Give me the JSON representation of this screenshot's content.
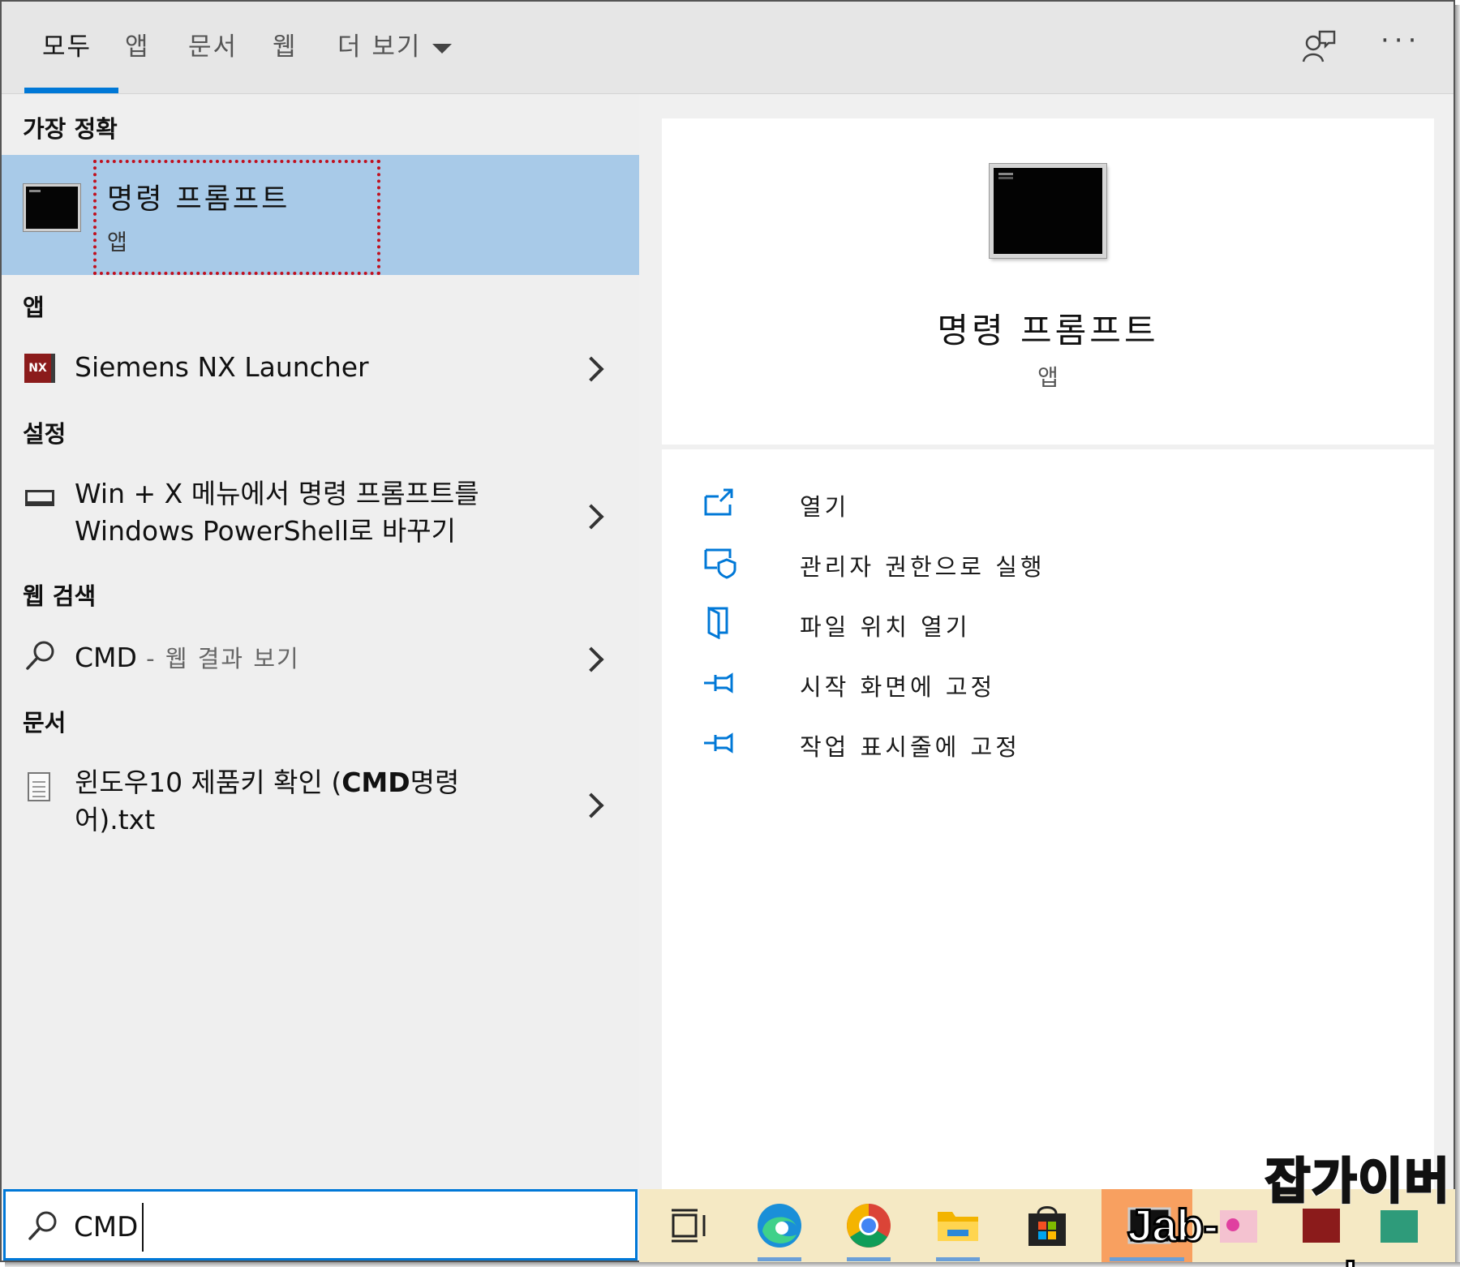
{
  "tabs": [
    {
      "label": "모두",
      "active": true
    },
    {
      "label": "앱"
    },
    {
      "label": "문서"
    },
    {
      "label": "웹"
    },
    {
      "label": "더 보기"
    }
  ],
  "topbar": {
    "more": "···"
  },
  "sections": {
    "best_match": "가장 정확",
    "apps": "앱",
    "settings": "설정",
    "web_search": "웹 검색",
    "documents": "문서"
  },
  "best_match": {
    "title": "명령 프롬프트",
    "subtitle": "앱"
  },
  "apps": [
    {
      "label": "Siemens NX Launcher",
      "icon_text": "NX"
    }
  ],
  "settings": [
    {
      "line1": "Win + X 메뉴에서 명령 프롬프트를",
      "line2": "Windows PowerShell로 바꾸기"
    }
  ],
  "web_search": [
    {
      "query": "CMD",
      "suffix": " - 웹 결과 보기"
    }
  ],
  "documents": [
    {
      "line1_plain": "윈도우10 제품키 확인 (",
      "line1_bold": "CMD",
      "line1_end": "명령",
      "line2": "어).txt"
    }
  ],
  "preview": {
    "title": "명령 프롬프트",
    "subtitle": "앱",
    "actions": [
      {
        "label": "열기",
        "icon": "open-icon"
      },
      {
        "label": "관리자 권한으로 실행",
        "icon": "admin-shield-icon"
      },
      {
        "label": "파일 위치 열기",
        "icon": "file-location-icon"
      },
      {
        "label": "시작 화면에 고정",
        "icon": "pin-icon"
      },
      {
        "label": "작업 표시줄에 고정",
        "icon": "pin-icon"
      }
    ]
  },
  "search": {
    "value": "CMD"
  },
  "watermark": {
    "korean": "잡가이버",
    "url": "Jab-guyver.co.kr"
  },
  "colors": {
    "accent": "#0078d7",
    "selection": "#a8cae8",
    "highlight_box": "#c0101e"
  }
}
